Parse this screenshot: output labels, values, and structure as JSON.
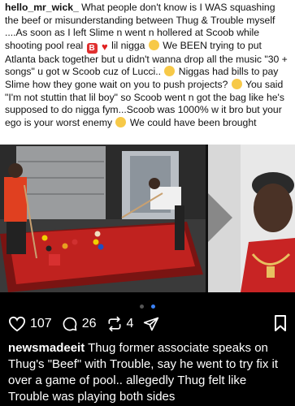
{
  "caption_image": {
    "username": "hello_mr_wick_",
    "part1": "What people don't know is I WAS squashing the beef or misunderstanding between Thug & Trouble myself ....As soon as I left Slime n went n hollered at Scoob while shooting pool  real",
    "part2": "lil nigga",
    "part3": "We BEEN trying to put Atlanta back together but u didn't wanna drop all the music \"30 + songs\" u got w Scoob cuz of Lucci..",
    "part4": "Niggas had bills to pay Slime how they gone wait on you to push projects?",
    "part5": "You said \"I'm not stuttin that lil boy\" so Scoob went n got the bag like he's supposed to do nigga fym...Scoob was 1000% w it bro but your ego is your worst enemy",
    "part6": "We could have been brought"
  },
  "carousel": {
    "pages": 2,
    "active": 1
  },
  "actions": {
    "likes": "107",
    "comments": "26",
    "reposts": "4"
  },
  "caption": {
    "username": "newsmadeeit",
    "text": "Thug former associate speaks on Thug's \"Beef\" with Trouble, say he went to try fix it over a game of pool.. allegedly Thug felt like Trouble was playing both sides"
  },
  "colors": {
    "accent": "#3b82f6",
    "background": "#000000",
    "pool_table": "#c0221f"
  },
  "icons": [
    "heart-icon",
    "comment-icon",
    "repost-icon",
    "send-icon",
    "bookmark-icon"
  ]
}
